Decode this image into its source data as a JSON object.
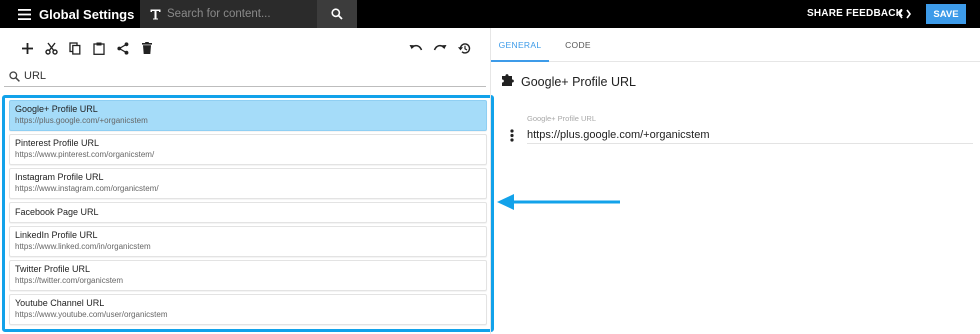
{
  "header": {
    "title": "Global Settings",
    "search_placeholder": "Search for content...",
    "share_feedback": "SHARE FEEDBACK",
    "save_label": "SAVE"
  },
  "filter": {
    "value": "URL"
  },
  "items": [
    {
      "title": "Google+ Profile URL",
      "subtitle": "https://plus.google.com/+organicstem"
    },
    {
      "title": "Pinterest Profile URL",
      "subtitle": "https://www.pinterest.com/organicstem/"
    },
    {
      "title": "Instagram Profile URL",
      "subtitle": "https://www.instagram.com/organicstem/"
    },
    {
      "title": "Facebook Page URL",
      "subtitle": ""
    },
    {
      "title": "LinkedIn Profile URL",
      "subtitle": "https://www.linked.com/in/organicstem"
    },
    {
      "title": "Twitter Profile URL",
      "subtitle": "https://twitter.com/organicstem"
    },
    {
      "title": "Youtube Channel URL",
      "subtitle": "https://www.youtube.com/user/organicstem"
    }
  ],
  "tabs": [
    {
      "label": "GENERAL",
      "active": true
    },
    {
      "label": "CODE",
      "active": false
    }
  ],
  "detail": {
    "title": "Google+ Profile URL",
    "field_label": "Google+ Profile URL",
    "field_value": "https://plus.google.com/+organicstem"
  },
  "colors": {
    "accent": "#3d9be9",
    "highlight_border": "#12a2ea",
    "selected_item": "#a5dcf9"
  }
}
